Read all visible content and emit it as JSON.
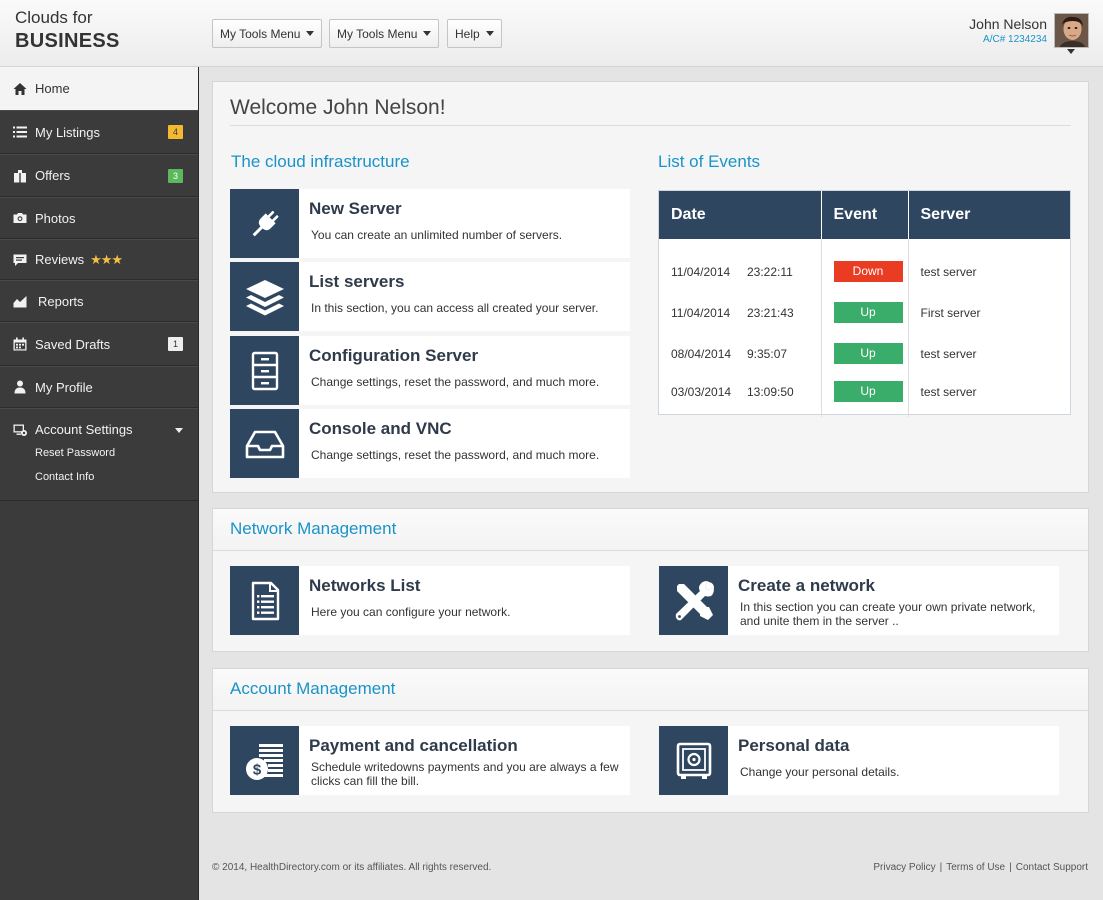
{
  "brand": {
    "line1": "Clouds for",
    "line2": "BUSINESS"
  },
  "menus": [
    {
      "label": "My Tools Menu"
    },
    {
      "label": "My Tools Menu"
    },
    {
      "label": "Help"
    }
  ],
  "user": {
    "name": "John Nelson",
    "account": "A/C# 1234234"
  },
  "sidebar": {
    "items": [
      {
        "label": "Home",
        "icon": "home-icon"
      },
      {
        "label": "My Listings",
        "icon": "list-icon",
        "badge": "4",
        "badge_color": "#f2b931"
      },
      {
        "label": "Offers",
        "icon": "gift-icon",
        "badge": "3",
        "badge_color": "#5cb85c"
      },
      {
        "label": "Photos",
        "icon": "camera-icon"
      },
      {
        "label": "Reviews",
        "icon": "comment-icon",
        "stars": "★★★"
      },
      {
        "label": "Reports",
        "icon": "chart-icon"
      },
      {
        "label": "Saved Drafts",
        "icon": "calendar-icon",
        "badge": "1",
        "badge_color": "#eeeeee"
      },
      {
        "label": "My Profile",
        "icon": "user-icon"
      },
      {
        "label": "Account Settings",
        "icon": "settings-icon"
      }
    ],
    "sub_items": [
      {
        "label": "Reset Password"
      },
      {
        "label": "Contact Info"
      }
    ]
  },
  "welcome": {
    "title": "Welcome John Nelson!"
  },
  "infrastructure": {
    "title": "The cloud infrastructure",
    "cards": [
      {
        "title": "New Server",
        "desc": "You can create an unlimited number of servers.",
        "icon": "plug-icon"
      },
      {
        "title": "List servers",
        "desc": "In this section, you can access all created your server.",
        "icon": "layers-icon"
      },
      {
        "title": "Configuration Server",
        "desc": "Change settings, reset the password, and much more.",
        "icon": "cabinet-icon"
      },
      {
        "title": "Console and VNC",
        "desc": "Change settings, reset the password, and much more.",
        "icon": "inbox-tray-icon"
      }
    ]
  },
  "events": {
    "title": "List of Events",
    "columns": [
      "Date",
      "Event",
      "Server"
    ],
    "rows": [
      {
        "date": "11/04/2014",
        "time": "23:22:11",
        "event": "Down",
        "server": "test server"
      },
      {
        "date": "11/04/2014",
        "time": "23:21:43",
        "event": "Up",
        "server": "First server"
      },
      {
        "date": "08/04/2014",
        "time": "9:35:07",
        "event": "Up",
        "server": "test server"
      },
      {
        "date": "03/03/2014",
        "time": "13:09:50",
        "event": "Up",
        "server": "test server"
      }
    ],
    "colors": {
      "down": "#ea3c23",
      "up": "#3bad6a",
      "header": "#2f4661"
    }
  },
  "network": {
    "title": "Network Management",
    "cards": [
      {
        "title": "Networks List",
        "desc": "Here you can configure your network.",
        "icon": "document-list-icon"
      },
      {
        "title": "Create a network",
        "desc": "In this section you can create your own private network, and unite them in the server ..",
        "icon": "tools-icon"
      }
    ]
  },
  "account": {
    "title": "Account Management",
    "cards": [
      {
        "title": "Payment and cancellation",
        "desc": "Schedule writedowns payments and you are always a few clicks can fill the bill.",
        "icon": "money-icon"
      },
      {
        "title": "Personal data",
        "desc": "Change your personal details.",
        "icon": "safe-icon"
      }
    ]
  },
  "footer": {
    "copyright": "© 2014, HealthDirectory.com or its affiliates. All rights reserved.",
    "links": [
      "Privacy Policy",
      "Terms of Use",
      "Contact Support"
    ]
  },
  "colors": {
    "accent": "#1a93c8",
    "icon_tile": "#2f4661",
    "sidebar": "#3b3b3b"
  }
}
